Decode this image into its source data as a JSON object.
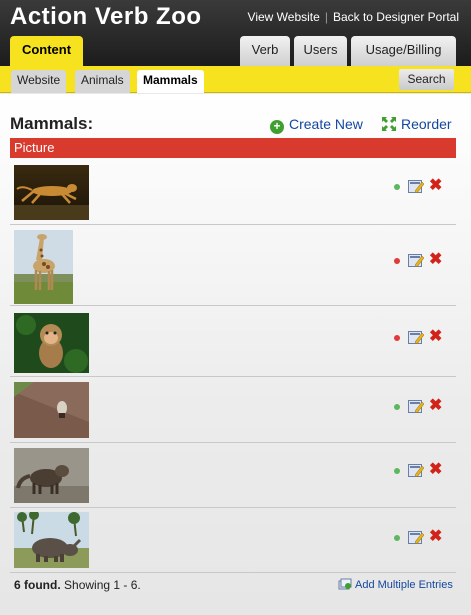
{
  "header": {
    "title": "Action Verb Zoo",
    "links": [
      "View Website",
      "Back to Designer Portal"
    ]
  },
  "tabs": {
    "content": "Content",
    "verb": "Verb",
    "users": "Users",
    "usage": "Usage/Billing"
  },
  "subtabs": {
    "website": "Website",
    "animals": "Animals",
    "mammals": "Mammals",
    "search": "Search"
  },
  "main": {
    "title": "Mammals:",
    "create_new": "Create New",
    "reorder": "Reorder",
    "column_header": "Picture"
  },
  "entries": [
    {
      "image": "cheetah-running",
      "status": "active",
      "status_color": "#5cb85c"
    },
    {
      "image": "giraffe",
      "status": "inactive",
      "status_color": "#e03a3a"
    },
    {
      "image": "monkey",
      "status": "inactive",
      "status_color": "#e03a3a"
    },
    {
      "image": "small-animal-on-road",
      "status": "active",
      "status_color": "#5cb85c"
    },
    {
      "image": "mongoose",
      "status": "active",
      "status_color": "#5cb85c"
    },
    {
      "image": "rhinoceros",
      "status": "active",
      "status_color": "#5cb85c"
    }
  ],
  "footer": {
    "found": "6 found.",
    "showing": "Showing 1 - 6.",
    "add_multiple": "Add Multiple Entries"
  },
  "colors": {
    "accent_yellow": "#f6e21e",
    "header_red": "#d93a2e",
    "link_blue": "#14479e",
    "delete_red": "#d2231b"
  }
}
